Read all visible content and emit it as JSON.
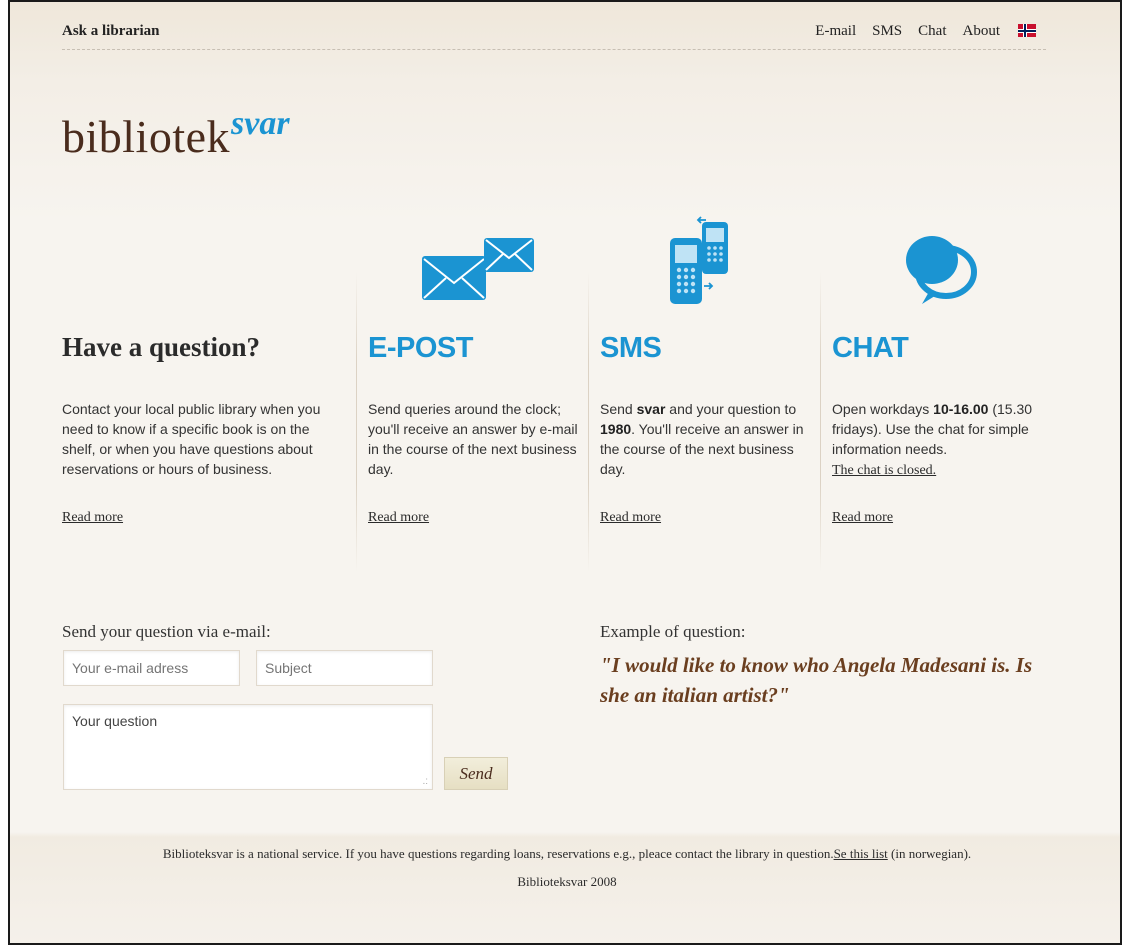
{
  "header": {
    "site_name": "Ask a librarian",
    "nav": [
      "E-mail",
      "SMS",
      "Chat",
      "About"
    ],
    "language_flag": "norwegian-flag"
  },
  "logo": {
    "main": "bibliotek",
    "accent": "svar",
    "accent_color": "#1b94d2"
  },
  "intro": {
    "title": "Have a question?",
    "text": "Contact your local public library when you need to know if a specific book is on the shelf, or when you have questions about reservations or hours of business.",
    "read_more": "Read more"
  },
  "email_col": {
    "icon": "envelope-icon",
    "title": "E-POST",
    "text": "Send queries around the clock; you'll receive an answer by e-mail in the course of the next business day.",
    "read_more": "Read more"
  },
  "sms_col": {
    "icon": "mobile-phones-icon",
    "title": "SMS",
    "text_1": "Send ",
    "keyword": "svar",
    "text_2": " and your question to ",
    "number": "1980",
    "text_3": ". You'll receive an answer in the course of the next business day.",
    "read_more": "Read more"
  },
  "chat_col": {
    "icon": "speech-bubble-icon",
    "title": "CHAT",
    "text_1": "Open workdays ",
    "hours": "10-16.00",
    "text_2": " (15.30 fridays). Use the chat for simple information needs.",
    "status_link": "The chat is closed.",
    "read_more": "Read more"
  },
  "form": {
    "title": "Send your question via e-mail:",
    "email_placeholder": "Your e-mail adress",
    "subject_placeholder": "Subject",
    "question_placeholder": "Your question",
    "send_label": "Send"
  },
  "example": {
    "label": "Example of question:",
    "quote": "\"I would like to know who Angela Madesani is. Is she an italian artist?\""
  },
  "footer": {
    "text": "Biblioteksvar is a national service. If you have questions regarding loans, reservations e.g., pleace contact the library in question.",
    "link": "Se this list",
    "suffix": " (in norwegian).",
    "copyright": "Biblioteksvar 2008"
  },
  "colors": {
    "accent": "#1b94d2",
    "brand_brown": "#4a2c1d",
    "quote": "#6a3e1f"
  }
}
